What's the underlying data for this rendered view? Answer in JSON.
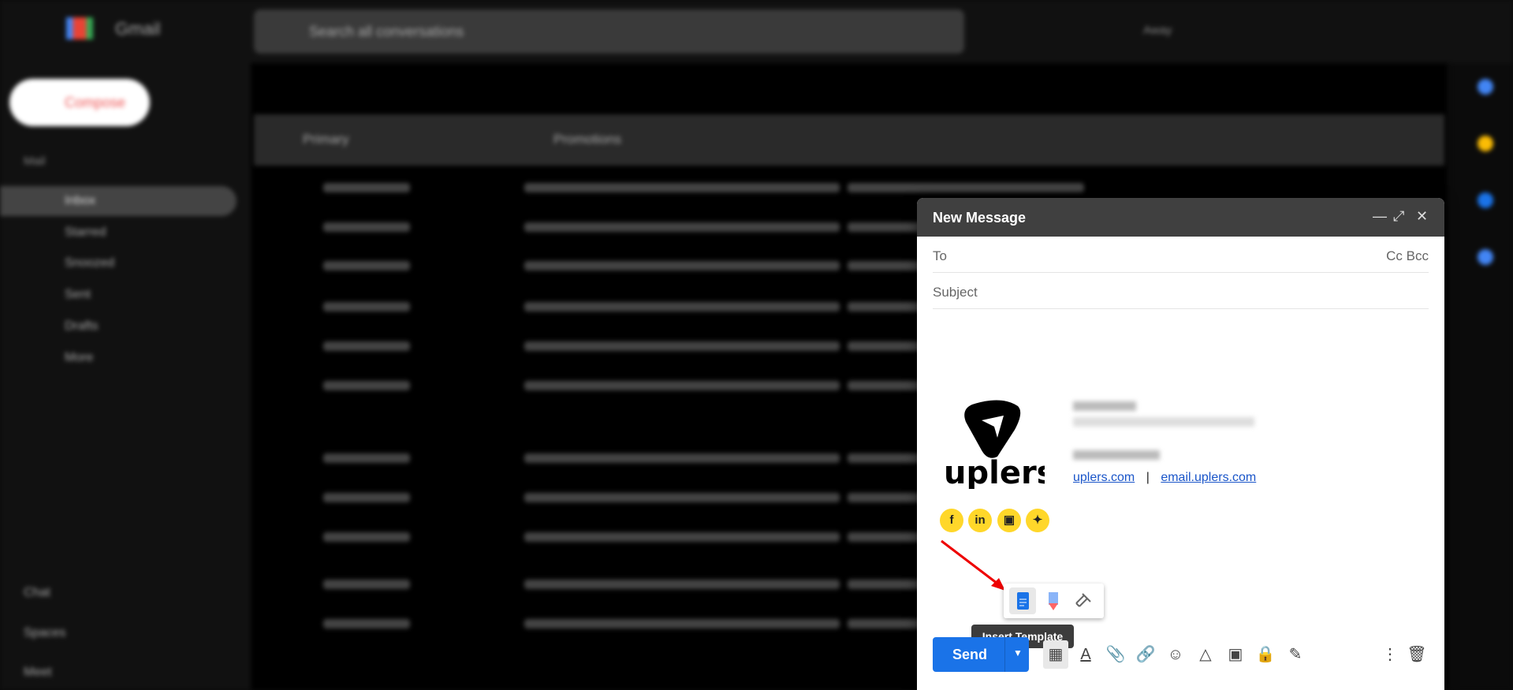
{
  "app": {
    "name": "Gmail",
    "search_placeholder": "Search all conversations",
    "status": "Away"
  },
  "sidebar": {
    "compose": "Compose",
    "section": "Mail",
    "items": [
      {
        "label": "Inbox",
        "active": true
      },
      {
        "label": "Starred"
      },
      {
        "label": "Snoozed"
      },
      {
        "label": "Sent"
      },
      {
        "label": "Drafts"
      },
      {
        "label": "More"
      }
    ],
    "bottom": [
      "Chat",
      "Spaces",
      "Meet"
    ]
  },
  "tabs": [
    "Primary",
    "Promotions"
  ],
  "compose": {
    "title": "New Message",
    "to_label": "To",
    "cc_bcc": "Cc Bcc",
    "subject_placeholder": "Subject",
    "signature": {
      "brand": "uplers",
      "links": [
        "uplers.com",
        "email.uplers.com"
      ],
      "separator": "|",
      "social": [
        "facebook",
        "linkedin",
        "instagram",
        "twitter"
      ],
      "brand_color": "#ffd72a"
    },
    "popup_tooltip": "Insert Template",
    "send_label": "Send",
    "accent": "#1a73e8"
  }
}
